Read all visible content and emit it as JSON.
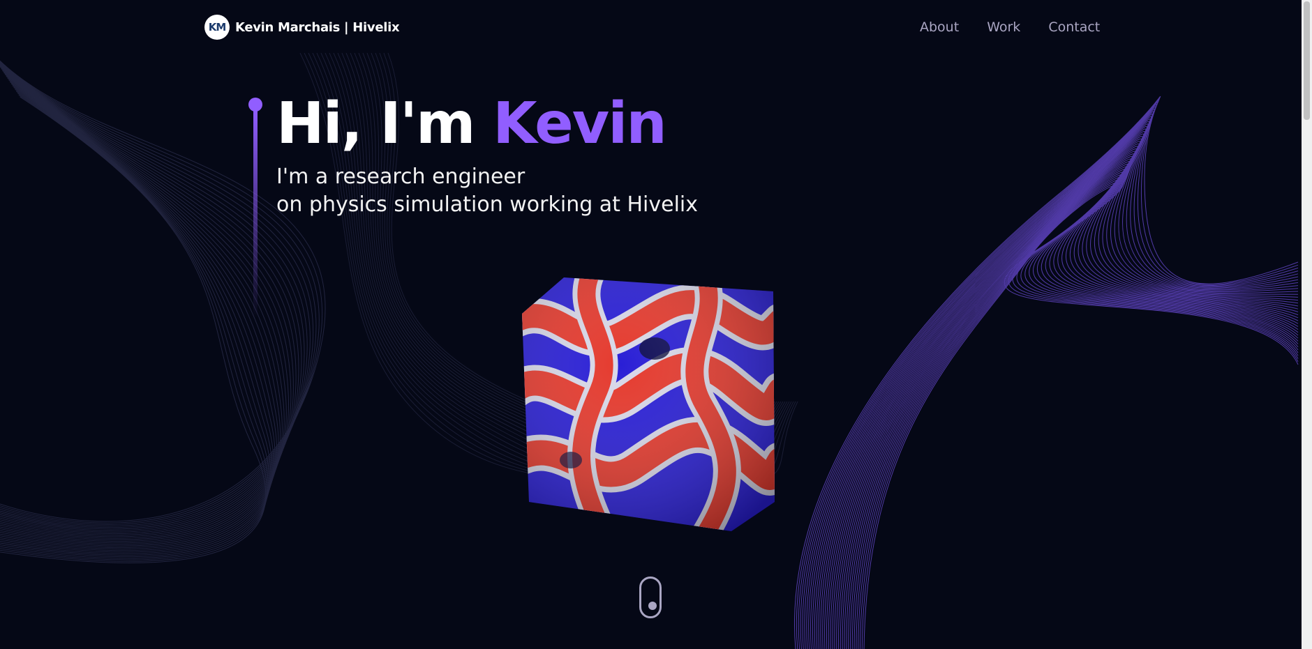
{
  "brand": {
    "logo_text": "KM",
    "name": "Kevin Marchais | Hivelix"
  },
  "nav": {
    "links": [
      "About",
      "Work",
      "Contact"
    ]
  },
  "hero": {
    "greeting": "Hi, I'm",
    "name": "Kevin",
    "subtitle_line1": "I'm a research engineer",
    "subtitle_line2": "on physics simulation working at Hivelix"
  },
  "colors": {
    "background": "#050816",
    "accent": "#915eff",
    "nav_text": "#aaa6c3",
    "simulation_red": "#e53a2e",
    "simulation_blue": "#2a1fd6"
  },
  "icons": {
    "scroll_indicator": "mouse-scroll-icon"
  }
}
